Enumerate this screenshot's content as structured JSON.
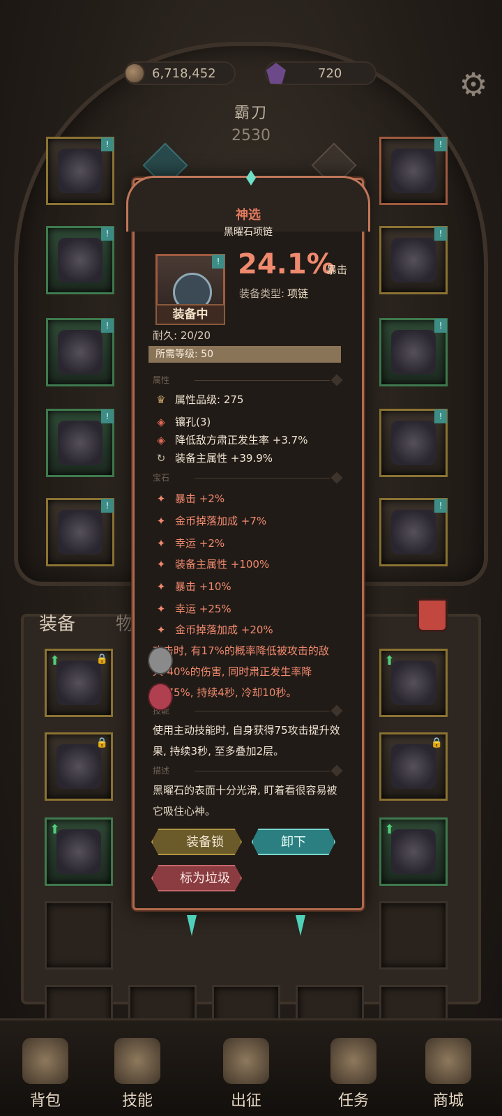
{
  "currency": {
    "gold": "6,718,452",
    "gems": "720"
  },
  "hero": {
    "name": "霸刀",
    "power": "2530"
  },
  "tabs": {
    "equip": "装备",
    "items": "物品"
  },
  "popup": {
    "rarity": "神选",
    "item_name": "黑曜石项链",
    "equipped_label": "装备中",
    "main_stat_value": "24.1%",
    "main_stat_label": "暴击",
    "type_label": "装备类型:",
    "type_value": "项链",
    "durability": "耐久: 20/20",
    "required_level": "所需等级: 50",
    "section_attributes": "属性",
    "attributes": [
      {
        "icon": "quality-icon",
        "text": "属性品级: 275"
      },
      {
        "icon": "socket-icon",
        "text": "镶孔(3)"
      },
      {
        "icon": "socket-icon",
        "text": "降低敌方肃正发生率 +3.7%"
      },
      {
        "icon": "cycle-icon",
        "text": "装备主属性 +39.9%"
      }
    ],
    "section_gems": "宝石",
    "gems": [
      "暴击 +2%",
      "金币掉落加成 +7%",
      "幸运 +2%",
      "装备主属性 +100%",
      "暴击 +10%",
      "幸运 +25%",
      "金币掉落加成 +20%"
    ],
    "effect_text": "攻击时, 有17%的概率降低被攻击的敌人-40%的伤害, 同时肃正发生率降低-75%, 持续4秒, 冷却10秒。",
    "section_skill": "技能",
    "skill_text": "使用主动技能时, 自身获得75攻击提升效果, 持续3秒, 至多叠加2层。",
    "section_desc": "描述",
    "desc_text": "黑曜石的表面十分光滑, 盯着看很容易被它吸住心神。",
    "btn_lock": "装备锁",
    "btn_unequip": "卸下",
    "btn_trash": "标为垃圾"
  },
  "nav": [
    {
      "label": "背包",
      "icon": "backpack-icon"
    },
    {
      "label": "技能",
      "icon": "skill-book-icon"
    },
    {
      "label": "出征",
      "icon": "sword-icon"
    },
    {
      "label": "任务",
      "icon": "quest-scroll-icon"
    },
    {
      "label": "商城",
      "icon": "shop-crown-icon"
    }
  ],
  "colors": {
    "rarity": "#e37a5e",
    "main_stat": "#f08a6e",
    "unequip": "#2b7f80",
    "lock": "#6b5a2a",
    "trash": "#8a3c40"
  }
}
